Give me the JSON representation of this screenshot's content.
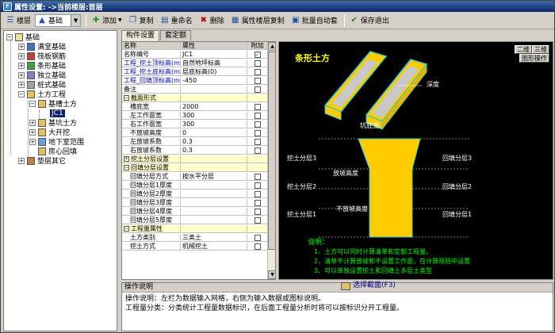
{
  "window": {
    "title": "属性设置: ->当前楼层:首层",
    "app_icon": "F"
  },
  "toolbar": {
    "floor_label": "楼层",
    "category_value": "基础",
    "add_label": "添加",
    "copy_label": "复制",
    "rename_label": "重命名",
    "delete_label": "删除",
    "copy_floor_attr_label": "属性楼层复制",
    "batch_auto_label": "批量自动套",
    "save_exit_label": "保存退出"
  },
  "tree": {
    "root": "基础",
    "items": [
      "满堂基础",
      "筏板钢筋",
      "条形基础",
      "独立基础",
      "桩式基础",
      "土方工程",
      "基槽土方",
      "JC1",
      "基坑土方",
      "大开挖",
      "地下室范围",
      "房心回填",
      "垫层其它"
    ]
  },
  "tabs": [
    "构件设置",
    "套定额"
  ],
  "grid": {
    "headers": {
      "name": "名称",
      "value": "属性",
      "add": "附加"
    },
    "rows": [
      {
        "name": "名称编号",
        "value": "JC1",
        "type": "normal",
        "checked": true
      },
      {
        "name": "工程_挖土顶标高(m)",
        "value": "自然地坪标高",
        "type": "blue",
        "checked": false
      },
      {
        "name": "工程_挖土底标高(m)",
        "value": "层底标高(0)",
        "type": "blue",
        "checked": false
      },
      {
        "name": "工程_回填顶标高(m)",
        "value": "-450",
        "type": "blue",
        "checked": false
      },
      {
        "name": "备注",
        "value": "",
        "type": "normal",
        "checked": false
      },
      {
        "name": "截面形式",
        "value": "",
        "type": "group",
        "exp": "−"
      },
      {
        "name": "槽底宽",
        "value": "2000",
        "type": "child",
        "checked": false
      },
      {
        "name": "左工作面宽",
        "value": "300",
        "type": "child",
        "checked": false
      },
      {
        "name": "右工作面宽",
        "value": "300",
        "type": "child",
        "checked": false
      },
      {
        "name": "不放坡高度",
        "value": "0",
        "type": "child",
        "checked": false
      },
      {
        "name": "左放坡系数",
        "value": "0.3",
        "type": "child",
        "checked": false
      },
      {
        "name": "右放坡系数",
        "value": "0.3",
        "type": "child",
        "checked": false
      },
      {
        "name": "挖土分层设置",
        "value": "",
        "type": "group",
        "exp": "+"
      },
      {
        "name": "回填分层设置",
        "value": "",
        "type": "group",
        "exp": "−"
      },
      {
        "name": "回填分层方式",
        "value": "按水平分层",
        "type": "child",
        "checked": false
      },
      {
        "name": "回填分层1厚度",
        "value": "",
        "type": "child",
        "checked": false
      },
      {
        "name": "回填分层2厚度",
        "value": "",
        "type": "child",
        "checked": false
      },
      {
        "name": "回填分层3厚度",
        "value": "",
        "type": "child",
        "checked": false
      },
      {
        "name": "回填分层4厚度",
        "value": "",
        "type": "child",
        "checked": false
      },
      {
        "name": "回填分层5厚度",
        "value": "",
        "type": "child",
        "checked": false
      },
      {
        "name": "工程量属性",
        "value": "",
        "type": "group",
        "exp": "−"
      },
      {
        "name": "土方类别",
        "value": "三类土",
        "type": "child",
        "checked": false
      },
      {
        "name": "挖土方式",
        "value": "机械挖土",
        "type": "child",
        "checked": false
      }
    ]
  },
  "canvas": {
    "title": "条形土方",
    "view_2d": "二维",
    "view_3d": "三维",
    "graphic_op": "图形操作",
    "label_depth": "深度",
    "label_pit_width": "坑底宽",
    "label_dig1": "挖土分层1",
    "label_dig2": "挖土分层2",
    "label_dig3": "挖土分层3",
    "label_fill1": "回填分层1",
    "label_fill2": "回填分层2",
    "label_fill3": "回填分层3",
    "label_slope_h": "放坡高度",
    "label_noslope_h": "不放坡高度",
    "note_title": "说明：",
    "note1": "1、土方可以同时计算清单和定额工程量。",
    "note2": "2、清单不计算放坡和不设置工作面，在计算规则中设置",
    "note3": "3、可以单独设置挖土和回填土多层土类型",
    "colors": {
      "slab": "#ffcc00",
      "edge": "#33cccc",
      "top": "#c8c8c8",
      "text": "#ffffff",
      "title": "#ffff00",
      "note": "#00ff00"
    }
  },
  "bottom": {
    "header": "操作说明",
    "pick_label": "选择截面(F3)",
    "line1": "操作说明：左栏为数据输入网格，右侧为输入数据或图标说明。",
    "line2": "工程量分类：分类统计工程量数据标识，在后面工程量分析时将可以按标识分开工程量。"
  }
}
